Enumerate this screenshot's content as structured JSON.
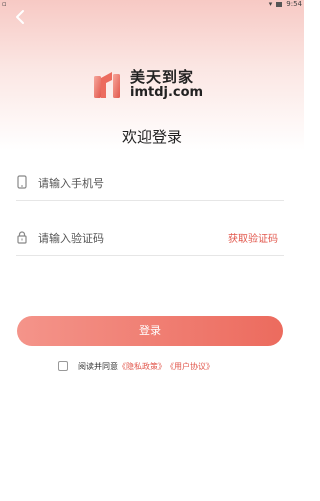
{
  "status_bar": {
    "time": "9:54"
  },
  "header": {
    "back_icon": "chevron-left-icon"
  },
  "brand": {
    "name_cn": "美天到家",
    "name_en": "imtdj.com",
    "accent_color": "#e2574c"
  },
  "page": {
    "title": "欢迎登录"
  },
  "form": {
    "phone": {
      "icon": "phone-icon",
      "placeholder": "请输入手机号",
      "value": ""
    },
    "code": {
      "icon": "lock-icon",
      "placeholder": "请输入验证码",
      "value": "",
      "get_code_label": "获取验证码"
    },
    "login_label": "登录"
  },
  "agreement": {
    "checked": false,
    "prefix": "阅读并同意",
    "privacy_link": "《隐私政策》",
    "terms_link": "《用户协议》"
  }
}
